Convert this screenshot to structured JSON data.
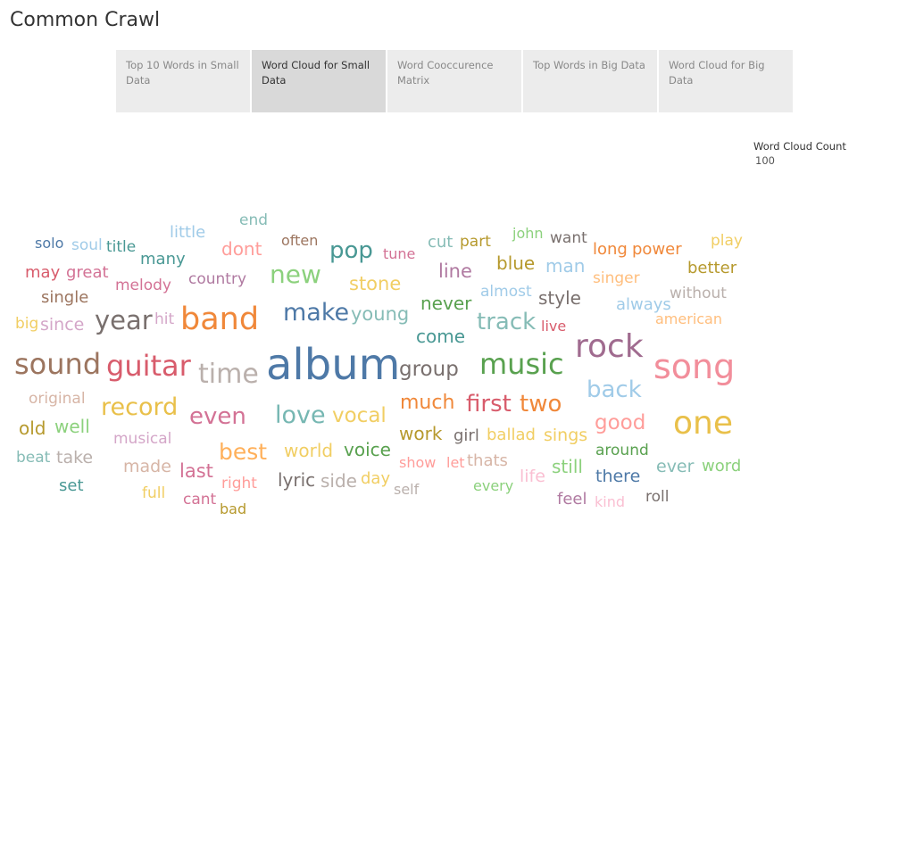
{
  "dashboard": {
    "title": "Common Crawl"
  },
  "tabs": [
    {
      "label": "Top 10 Words in Small Data",
      "active": false
    },
    {
      "label": "Word Cloud for Small Data",
      "active": true
    },
    {
      "label": "Word Cooccurence Matrix",
      "active": false
    },
    {
      "label": "Top Words in Big Data",
      "active": false
    },
    {
      "label": "Word Cloud for Big Data",
      "active": false
    }
  ],
  "legend": {
    "title": "Word Cloud Count",
    "value": "100"
  },
  "chart_data": {
    "type": "word-cloud",
    "words": [
      {
        "text": "album",
        "color": "#4e79a7",
        "size": 48
      },
      {
        "text": "song",
        "color": "#f28e9b",
        "size": 38
      },
      {
        "text": "rock",
        "color": "#a06b8f",
        "size": 36
      },
      {
        "text": "one",
        "color": "#e9c04a",
        "size": 36
      },
      {
        "text": "band",
        "color": "#f0883a",
        "size": 35
      },
      {
        "text": "sound",
        "color": "#9c755f",
        "size": 32
      },
      {
        "text": "guitar",
        "color": "#d85c6c",
        "size": 32
      },
      {
        "text": "music",
        "color": "#59a14f",
        "size": 32
      },
      {
        "text": "time",
        "color": "#bab0ac",
        "size": 30
      },
      {
        "text": "year",
        "color": "#79706e",
        "size": 29
      },
      {
        "text": "make",
        "color": "#4e79a7",
        "size": 27
      },
      {
        "text": "love",
        "color": "#76b7b2",
        "size": 27
      },
      {
        "text": "back",
        "color": "#a0cbe8",
        "size": 26
      },
      {
        "text": "new",
        "color": "#8cd17d",
        "size": 28
      },
      {
        "text": "record",
        "color": "#e9c04a",
        "size": 27
      },
      {
        "text": "track",
        "color": "#86bcb6",
        "size": 26
      },
      {
        "text": "even",
        "color": "#d37295",
        "size": 26
      },
      {
        "text": "pop",
        "color": "#499894",
        "size": 26
      },
      {
        "text": "first",
        "color": "#d85c6c",
        "size": 26
      },
      {
        "text": "two",
        "color": "#f0883a",
        "size": 26
      },
      {
        "text": "best",
        "color": "#ffb05a",
        "size": 25
      },
      {
        "text": "group",
        "color": "#79706e",
        "size": 23
      },
      {
        "text": "good",
        "color": "#ff9d9a",
        "size": 23
      },
      {
        "text": "vocal",
        "color": "#f1ce63",
        "size": 23
      },
      {
        "text": "much",
        "color": "#f0883a",
        "size": 22
      },
      {
        "text": "young",
        "color": "#86bcb6",
        "size": 21
      },
      {
        "text": "line",
        "color": "#b07aa1",
        "size": 21
      },
      {
        "text": "stone",
        "color": "#f1ce63",
        "size": 21
      },
      {
        "text": "voice",
        "color": "#59a14f",
        "size": 20
      },
      {
        "text": "last",
        "color": "#d37295",
        "size": 21
      },
      {
        "text": "come",
        "color": "#499894",
        "size": 20
      },
      {
        "text": "never",
        "color": "#59a14f",
        "size": 20
      },
      {
        "text": "man",
        "color": "#a0cbe8",
        "size": 20
      },
      {
        "text": "blue",
        "color": "#b6992d",
        "size": 20
      },
      {
        "text": "style",
        "color": "#79706e",
        "size": 20
      },
      {
        "text": "work",
        "color": "#b6992d",
        "size": 20
      },
      {
        "text": "world",
        "color": "#f1ce63",
        "size": 20
      },
      {
        "text": "lyric",
        "color": "#79706e",
        "size": 20
      },
      {
        "text": "side",
        "color": "#bab0ac",
        "size": 20
      },
      {
        "text": "still",
        "color": "#8cd17d",
        "size": 20
      },
      {
        "text": "there",
        "color": "#4e79a7",
        "size": 19
      },
      {
        "text": "well",
        "color": "#8cd17d",
        "size": 20
      },
      {
        "text": "old",
        "color": "#b6992d",
        "size": 20
      },
      {
        "text": "sings",
        "color": "#f1ce63",
        "size": 19
      },
      {
        "text": "ballad",
        "color": "#f1ce63",
        "size": 18
      },
      {
        "text": "girl",
        "color": "#79706e",
        "size": 18
      },
      {
        "text": "thats",
        "color": "#d7b5a6",
        "size": 18
      },
      {
        "text": "made",
        "color": "#d7b5a6",
        "size": 19
      },
      {
        "text": "take",
        "color": "#bab0ac",
        "size": 19
      },
      {
        "text": "ever",
        "color": "#86bcb6",
        "size": 19
      },
      {
        "text": "word",
        "color": "#8cd17d",
        "size": 18
      },
      {
        "text": "life",
        "color": "#fabfd2",
        "size": 19
      },
      {
        "text": "day",
        "color": "#f1ce63",
        "size": 18
      },
      {
        "text": "dont",
        "color": "#ff9d9a",
        "size": 20
      },
      {
        "text": "part",
        "color": "#b6992d",
        "size": 17
      },
      {
        "text": "cut",
        "color": "#86bcb6",
        "size": 18
      },
      {
        "text": "power",
        "color": "#f0883a",
        "size": 18
      },
      {
        "text": "long",
        "color": "#f0883a",
        "size": 18
      },
      {
        "text": "singer",
        "color": "#ffbe7d",
        "size": 17
      },
      {
        "text": "better",
        "color": "#b6992d",
        "size": 18
      },
      {
        "text": "always",
        "color": "#a0cbe8",
        "size": 18
      },
      {
        "text": "many",
        "color": "#499894",
        "size": 18
      },
      {
        "text": "single",
        "color": "#9c755f",
        "size": 18
      },
      {
        "text": "since",
        "color": "#d4a6c8",
        "size": 19
      },
      {
        "text": "little",
        "color": "#a0cbe8",
        "size": 18
      },
      {
        "text": "great",
        "color": "#d37295",
        "size": 18
      },
      {
        "text": "may",
        "color": "#d85c6c",
        "size": 18
      },
      {
        "text": "melody",
        "color": "#d37295",
        "size": 17
      },
      {
        "text": "country",
        "color": "#b07aa1",
        "size": 17
      },
      {
        "text": "hit",
        "color": "#d4a6c8",
        "size": 17
      },
      {
        "text": "big",
        "color": "#f1ce63",
        "size": 17
      },
      {
        "text": "almost",
        "color": "#a0cbe8",
        "size": 17
      },
      {
        "text": "around",
        "color": "#59a14f",
        "size": 17
      },
      {
        "text": "original",
        "color": "#d7b5a6",
        "size": 17
      },
      {
        "text": "musical",
        "color": "#d4a6c8",
        "size": 17
      },
      {
        "text": "beat",
        "color": "#86bcb6",
        "size": 17
      },
      {
        "text": "set",
        "color": "#499894",
        "size": 18
      },
      {
        "text": "full",
        "color": "#f1ce63",
        "size": 17
      },
      {
        "text": "cant",
        "color": "#d37295",
        "size": 17
      },
      {
        "text": "right",
        "color": "#ff9d9a",
        "size": 17
      },
      {
        "text": "bad",
        "color": "#b6992d",
        "size": 16
      },
      {
        "text": "show",
        "color": "#ff9d9a",
        "size": 16
      },
      {
        "text": "let",
        "color": "#ff9d9a",
        "size": 16
      },
      {
        "text": "self",
        "color": "#bab0ac",
        "size": 16
      },
      {
        "text": "every",
        "color": "#8cd17d",
        "size": 16
      },
      {
        "text": "feel",
        "color": "#b07aa1",
        "size": 18
      },
      {
        "text": "kind",
        "color": "#fabfd2",
        "size": 16
      },
      {
        "text": "roll",
        "color": "#79706e",
        "size": 17
      },
      {
        "text": "want",
        "color": "#79706e",
        "size": 17
      },
      {
        "text": "john",
        "color": "#8cd17d",
        "size": 16
      },
      {
        "text": "play",
        "color": "#f1ce63",
        "size": 17
      },
      {
        "text": "without",
        "color": "#bab0ac",
        "size": 17
      },
      {
        "text": "american",
        "color": "#ffbe7d",
        "size": 16
      },
      {
        "text": "live",
        "color": "#d85c6c",
        "size": 16
      },
      {
        "text": "tune",
        "color": "#d37295",
        "size": 16
      },
      {
        "text": "often",
        "color": "#9c755f",
        "size": 16
      },
      {
        "text": "end",
        "color": "#86bcb6",
        "size": 17
      },
      {
        "text": "title",
        "color": "#499894",
        "size": 17
      },
      {
        "text": "soul",
        "color": "#a0cbe8",
        "size": 17
      },
      {
        "text": "solo",
        "color": "#4e79a7",
        "size": 16
      }
    ]
  }
}
